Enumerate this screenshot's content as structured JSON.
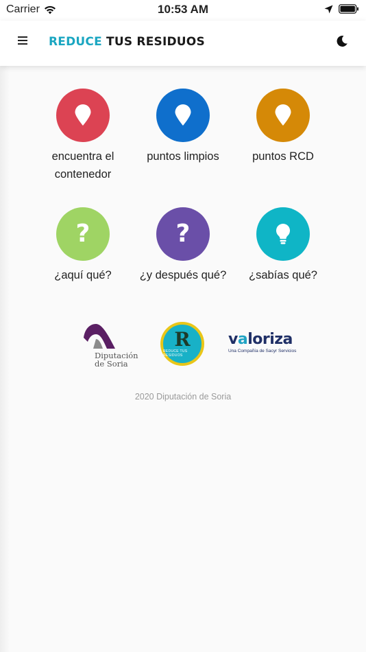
{
  "status_bar": {
    "carrier": "Carrier",
    "time": "10:53 AM",
    "icons": [
      "wifi-icon",
      "location-arrow-icon",
      "battery-icon"
    ]
  },
  "app_bar": {
    "title_part1": "REDUCE",
    "title_part2": "TUS RESIDUOS",
    "title_color_1": "#1aa6c1",
    "title_color_2": "#1a1a1a",
    "left_icon": "menu-icon",
    "right_icon": "moon-icon"
  },
  "tiles": [
    {
      "label": "encuentra el contenedor",
      "color": "#dc4353",
      "icon": "map-pin-icon"
    },
    {
      "label": "puntos limpios",
      "color": "#0f6fcc",
      "icon": "map-pin-icon"
    },
    {
      "label": "puntos RCD",
      "color": "#d58907",
      "icon": "map-pin-icon"
    },
    {
      "label": "¿aquí qué?",
      "color": "#9fd464",
      "icon": "question-icon"
    },
    {
      "label": "¿y después qué?",
      "color": "#6a4fa8",
      "icon": "question-icon"
    },
    {
      "label": "¿sabías qué?",
      "color": "#0fb5c6",
      "icon": "lightbulb-icon"
    }
  ],
  "logos": {
    "diputacion_line1": "Diputación",
    "diputacion_line2": "de Soria",
    "reduce_letter": "R",
    "reduce_small": "REDUCE TUS RESIDUOS",
    "valoriza_pre": "v",
    "valoriza_acc": "a",
    "valoriza_post": "loriza",
    "valoriza_sub": "Una Compañía de Sacyr Servicios"
  },
  "footer": {
    "text": "2020 Diputación de Soria"
  }
}
